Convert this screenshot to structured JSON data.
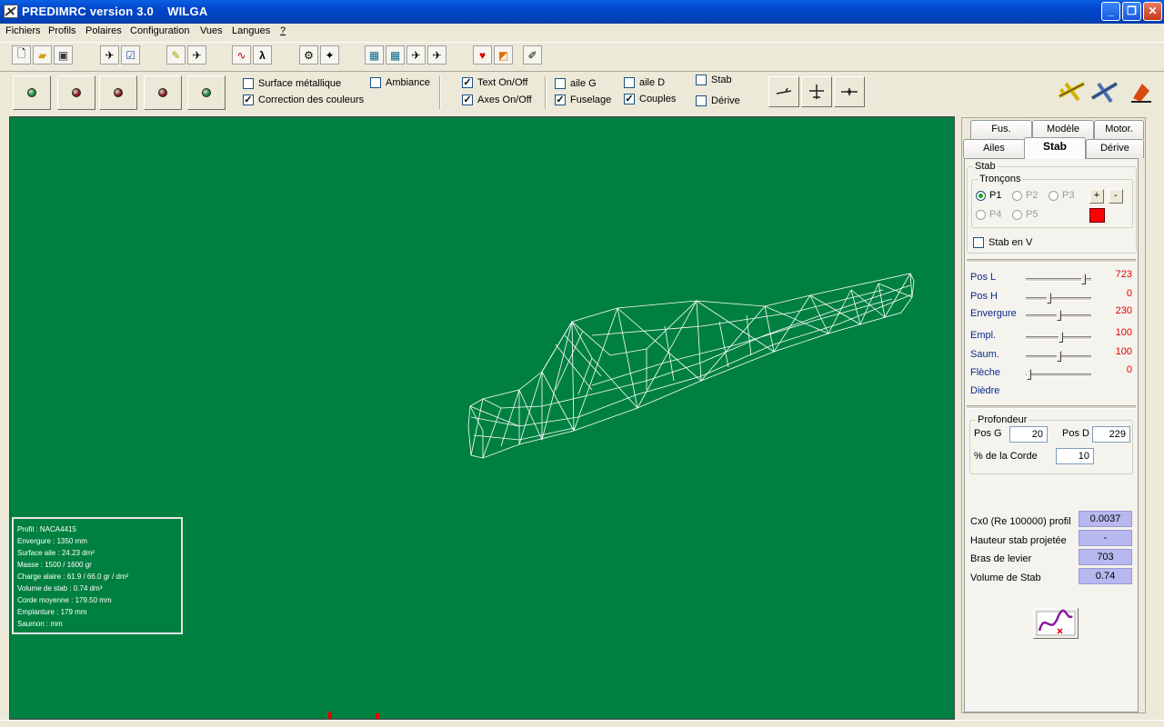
{
  "window": {
    "title": "PREDIMRC version 3.0    WILGA",
    "controls": {
      "minimize": "_",
      "restore": "❐",
      "close": "✕"
    }
  },
  "menu": [
    "Fichiers",
    "Profils",
    "Polaires",
    "Configuration",
    "Vues",
    "Langues",
    "?"
  ],
  "toolbar": {
    "icons": [
      "new-file-icon",
      "open-folder-icon",
      "save-icon",
      "profile-tool-icon",
      "checklist-icon",
      "pencil-icon",
      "plane-icon",
      "polar-curve-icon",
      "lambda-icon",
      "engine-icon",
      "propeller-icon",
      "calculator-icon",
      "calculator-icon",
      "plane-top-icon",
      "plane-front-icon",
      "heart-icon",
      "chart-icon",
      "eraser-icon"
    ]
  },
  "display_options": {
    "surface_metallique": {
      "label": "Surface métallique",
      "checked": false
    },
    "correction_couleurs": {
      "label": "Correction des couleurs",
      "checked": true
    },
    "ambiance": {
      "label": "Ambiance",
      "checked": false
    },
    "text_onoff": {
      "label": "Text On/Off",
      "checked": true
    },
    "axes_onoff": {
      "label": "Axes On/Off",
      "checked": true
    },
    "aile_g": {
      "label": "aile G",
      "checked": false
    },
    "fuselage": {
      "label": "Fuselage",
      "checked": true
    },
    "aile_d": {
      "label": "aile D",
      "checked": false
    },
    "couples": {
      "label": "Couples",
      "checked": true
    },
    "stab": {
      "label": "Stab",
      "checked": false
    },
    "derive": {
      "label": "Dérive",
      "checked": false
    }
  },
  "color_buttons": [
    "#1f8a3a",
    "#8a1a1a",
    "#8a1a1a",
    "#8a1a1a",
    "#1f8a3a"
  ],
  "info_box": [
    "Profil : NACA4415",
    "Envergure : 1350 mm",
    "Surface aile : 24.23 dm²",
    "Masse : 1500 / 1600 gr",
    "Charge alaire : 61.9 / 66.0 gr / dm²",
    "Volume de stab : 0.74 dm³",
    "Corde moyenne : 179.50 mm",
    "Emplanture : 179 mm",
    "Saumon : mm"
  ],
  "tabs": {
    "row1": [
      "Fus.",
      "Modèle",
      "Motor."
    ],
    "row2": [
      "Ailes",
      "Stab",
      "Dérive"
    ],
    "active": "Stab"
  },
  "stab_panel": {
    "group_label": "Stab",
    "troncons_label": "Tronçons",
    "segments": [
      "P1",
      "P2",
      "P3",
      "P4",
      "P5"
    ],
    "selected_segment": "P1",
    "add_label": "+",
    "remove_label": "-",
    "segment_color": "#ff0000",
    "stab_en_v": {
      "label": "Stab en V",
      "checked": false
    }
  },
  "params": [
    {
      "label": "Pos L",
      "value": "723",
      "level": 0.93
    },
    {
      "label": "Pos H",
      "value": "0",
      "level": 0.35
    },
    {
      "label": "Envergure",
      "value": "230",
      "level": 0.52
    },
    {
      "label": "Empl.",
      "value": "100",
      "level": 0.55
    },
    {
      "label": "Saum.",
      "value": "100",
      "level": 0.52
    },
    {
      "label": "Flèche",
      "value": "0",
      "level": 0.02
    },
    {
      "label": "Dièdre",
      "value": "",
      "level": null
    }
  ],
  "profondeur": {
    "label": "Profondeur",
    "pos_g_label": "Pos G",
    "pos_g_value": "20",
    "pos_d_label": "Pos D",
    "pos_d_value": "229",
    "corde_label": "% de la Corde",
    "corde_value": "10"
  },
  "results": [
    {
      "label": "Cx0 (Re 100000) profil",
      "value": "0.0037"
    },
    {
      "label": "Hauteur stab projetée",
      "value": "-"
    },
    {
      "label": "Bras de levier",
      "value": "703"
    },
    {
      "label": "Volume de Stab",
      "value": "0.74"
    }
  ]
}
